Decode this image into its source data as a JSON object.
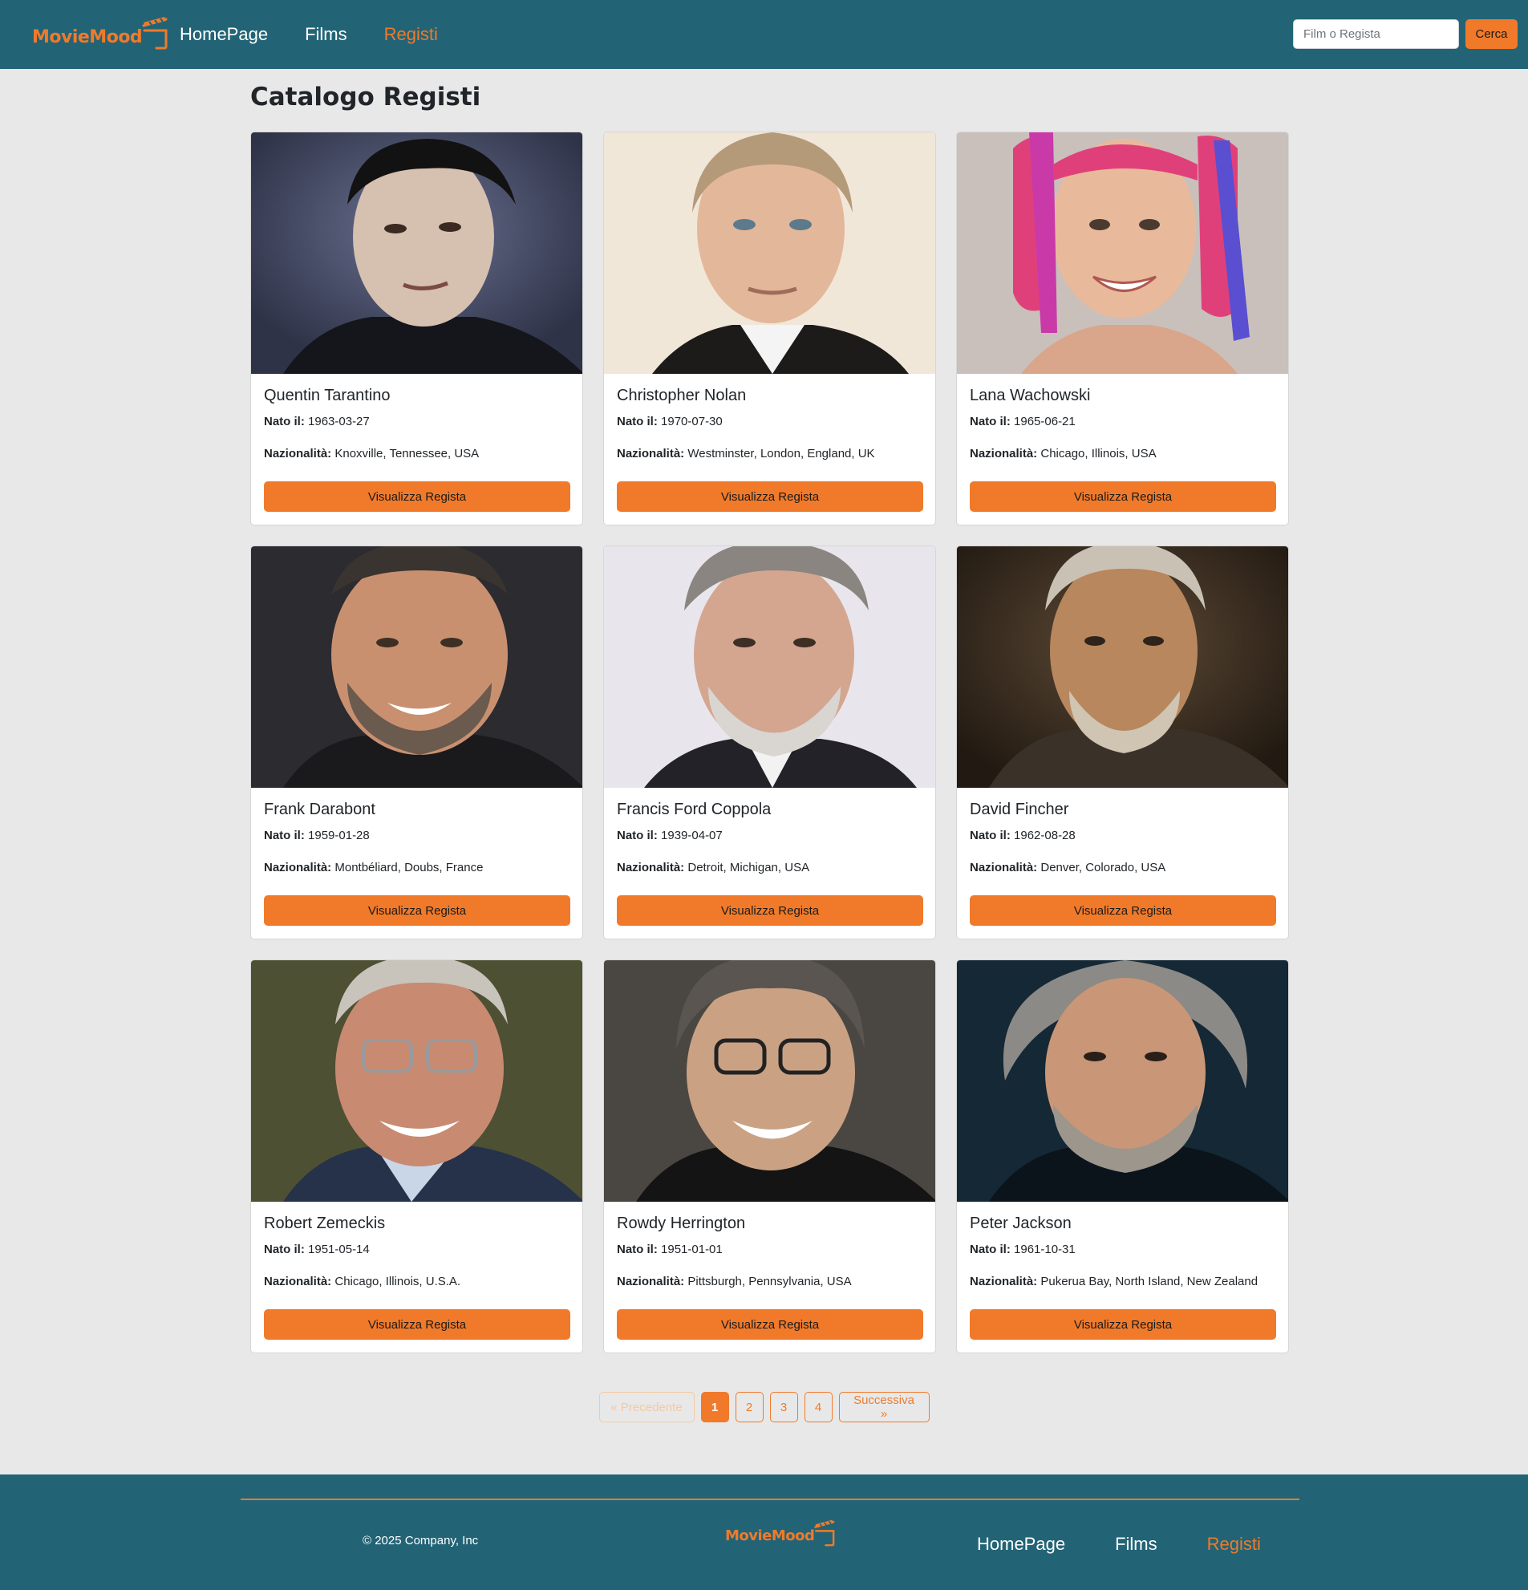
{
  "brand": {
    "name": "MovieMood",
    "icon": "clapperboard-icon",
    "color": "#f07a2a"
  },
  "nav": {
    "links": [
      "HomePage",
      "Films",
      "Registi"
    ],
    "active": "Registi"
  },
  "search": {
    "placeholder": "Film o Regista",
    "button_label": "Cerca"
  },
  "page_title": "Catalogo Registi",
  "labels": {
    "born": "Nato il:",
    "nationality": "Nazionalità:",
    "view_button": "Visualizza Regista"
  },
  "directors": [
    {
      "name": "Quentin Tarantino",
      "born": "1963-03-27",
      "nationality": "Knoxville, Tennessee, USA"
    },
    {
      "name": "Christopher Nolan",
      "born": "1970-07-30",
      "nationality": "Westminster, London, England, UK"
    },
    {
      "name": "Lana Wachowski",
      "born": "1965-06-21",
      "nationality": "Chicago, Illinois, USA"
    },
    {
      "name": "Frank Darabont",
      "born": "1959-01-28",
      "nationality": "Montbéliard, Doubs, France"
    },
    {
      "name": "Francis Ford Coppola",
      "born": "1939-04-07",
      "nationality": "Detroit, Michigan, USA"
    },
    {
      "name": "David Fincher",
      "born": "1962-08-28",
      "nationality": "Denver, Colorado, USA"
    },
    {
      "name": "Robert Zemeckis",
      "born": "1951-05-14",
      "nationality": "Chicago, Illinois, U.S.A."
    },
    {
      "name": "Rowdy Herrington",
      "born": "1951-01-01",
      "nationality": "Pittsburgh, Pennsylvania, USA"
    },
    {
      "name": "Peter Jackson",
      "born": "1961-10-31",
      "nationality": "Pukerua Bay, North Island, New Zealand"
    }
  ],
  "pagination": {
    "prev_label": "« Precedente",
    "next_label": "Successiva »",
    "pages": [
      "1",
      "2",
      "3",
      "4"
    ],
    "current": "1",
    "prev_disabled": true
  },
  "footer": {
    "copyright": "© 2025 Company, Inc",
    "links": [
      "HomePage",
      "Films",
      "Registi"
    ],
    "active": "Registi"
  },
  "colors": {
    "header_bg": "#226476",
    "accent": "#f07a2a",
    "page_bg": "#e8e8e8"
  }
}
